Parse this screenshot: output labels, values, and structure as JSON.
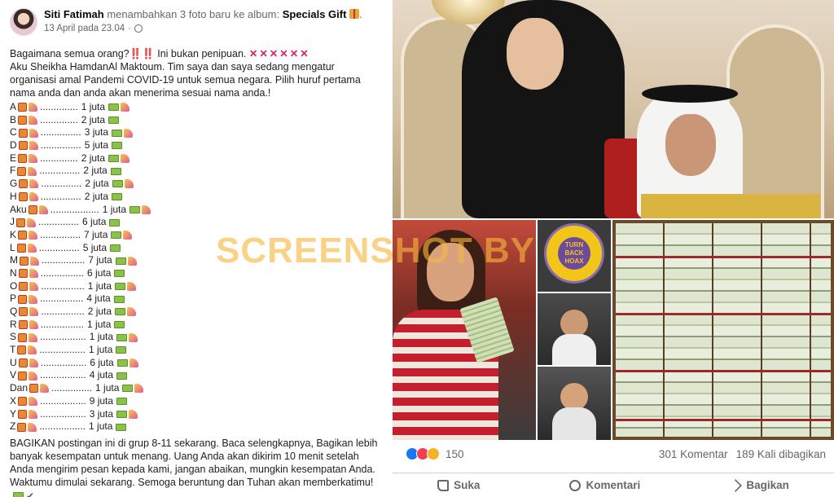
{
  "post": {
    "author": "Siti Fatimah",
    "action": "menambahkan 3 foto baru ke album:",
    "album": "Specials Gift",
    "timestamp": "13 April pada 23.04",
    "intro_line1": "Bagaimana semua orang?",
    "intro_line1_b": "Ini bukan penipuan.",
    "intro_bangs": "‼️‼️",
    "intro_xs": "✕✕✕✕✕✕",
    "intro_rest": "Aku Sheikha HamdanAl Maktoum. Tim saya dan saya sedang mengatur organisasi amal Pandemi COVID-19 untuk semua negara. Pilih huruf pertama nama anda dan anda akan menerima sesuai nama anda.!",
    "prizes": [
      {
        "letter": "A",
        "dots": "..............",
        "amount": "1 juta"
      },
      {
        "letter": "B",
        "dots": "..............",
        "amount": "2 juta"
      },
      {
        "letter": "C",
        "dots": "...............",
        "amount": "3 juta"
      },
      {
        "letter": "D",
        "dots": "...............",
        "amount": "5 juta"
      },
      {
        "letter": "E",
        "dots": "..............",
        "amount": "2 juta"
      },
      {
        "letter": "F",
        "dots": "...............",
        "amount": "2 juta"
      },
      {
        "letter": "G",
        "dots": "...............",
        "amount": "2 juta"
      },
      {
        "letter": "H",
        "dots": "...............",
        "amount": "2 juta"
      },
      {
        "letter": "Aku",
        "dots": "..................",
        "amount": "1 juta"
      },
      {
        "letter": "J",
        "dots": "...............",
        "amount": "6 juta"
      },
      {
        "letter": "K",
        "dots": "...............",
        "amount": "7 juta"
      },
      {
        "letter": "L",
        "dots": "...............",
        "amount": "5 juta"
      },
      {
        "letter": "M",
        "dots": "................",
        "amount": "7 juta"
      },
      {
        "letter": "N",
        "dots": "................",
        "amount": "6 juta"
      },
      {
        "letter": "O",
        "dots": "................",
        "amount": "1 juta"
      },
      {
        "letter": "P",
        "dots": "................",
        "amount": "4 juta"
      },
      {
        "letter": "Q",
        "dots": "................",
        "amount": "2 juta"
      },
      {
        "letter": "R",
        "dots": "................",
        "amount": "1 juta"
      },
      {
        "letter": "S",
        "dots": ".................",
        "amount": "1 juta"
      },
      {
        "letter": "T",
        "dots": ".................",
        "amount": "1 juta"
      },
      {
        "letter": "U",
        "dots": ".................",
        "amount": "6 juta"
      },
      {
        "letter": "V",
        "dots": ".................",
        "amount": "4 juta"
      },
      {
        "letter": "Dan",
        "dots": "...............",
        "amount": "1 juta"
      },
      {
        "letter": "X",
        "dots": ".................",
        "amount": "9 juta"
      },
      {
        "letter": "Y",
        "dots": ".................",
        "amount": "3 juta"
      },
      {
        "letter": "Z",
        "dots": ".................",
        "amount": "1 juta"
      }
    ],
    "outro": "BAGIKAN postingan ini di grup 8-11 sekarang. Baca selengkapnya, Bagikan lebih banyak kesempatan untuk menang. Uang Anda akan dikirim 10 menit setelah Anda mengirim pesan kepada kami, jangan abaikan, mungkin kesempatan Anda. Waktumu dimulai sekarang. Semoga beruntung dan Tuhan akan memberkatimu!",
    "outro_check": "✔"
  },
  "photos": {
    "badge_text": "TURN BACK HOAX",
    "watermark": "SCREENSHOT BY"
  },
  "reactions": {
    "count": "150",
    "comments": "301 Komentar",
    "shares": "189 Kali dibagikan"
  },
  "actions": {
    "like": "Suka",
    "comment": "Komentari",
    "share": "Bagikan"
  },
  "colors": {
    "link_blue": "#1877f2",
    "text_gray": "#65676b",
    "watermark": "#f7b63c"
  }
}
